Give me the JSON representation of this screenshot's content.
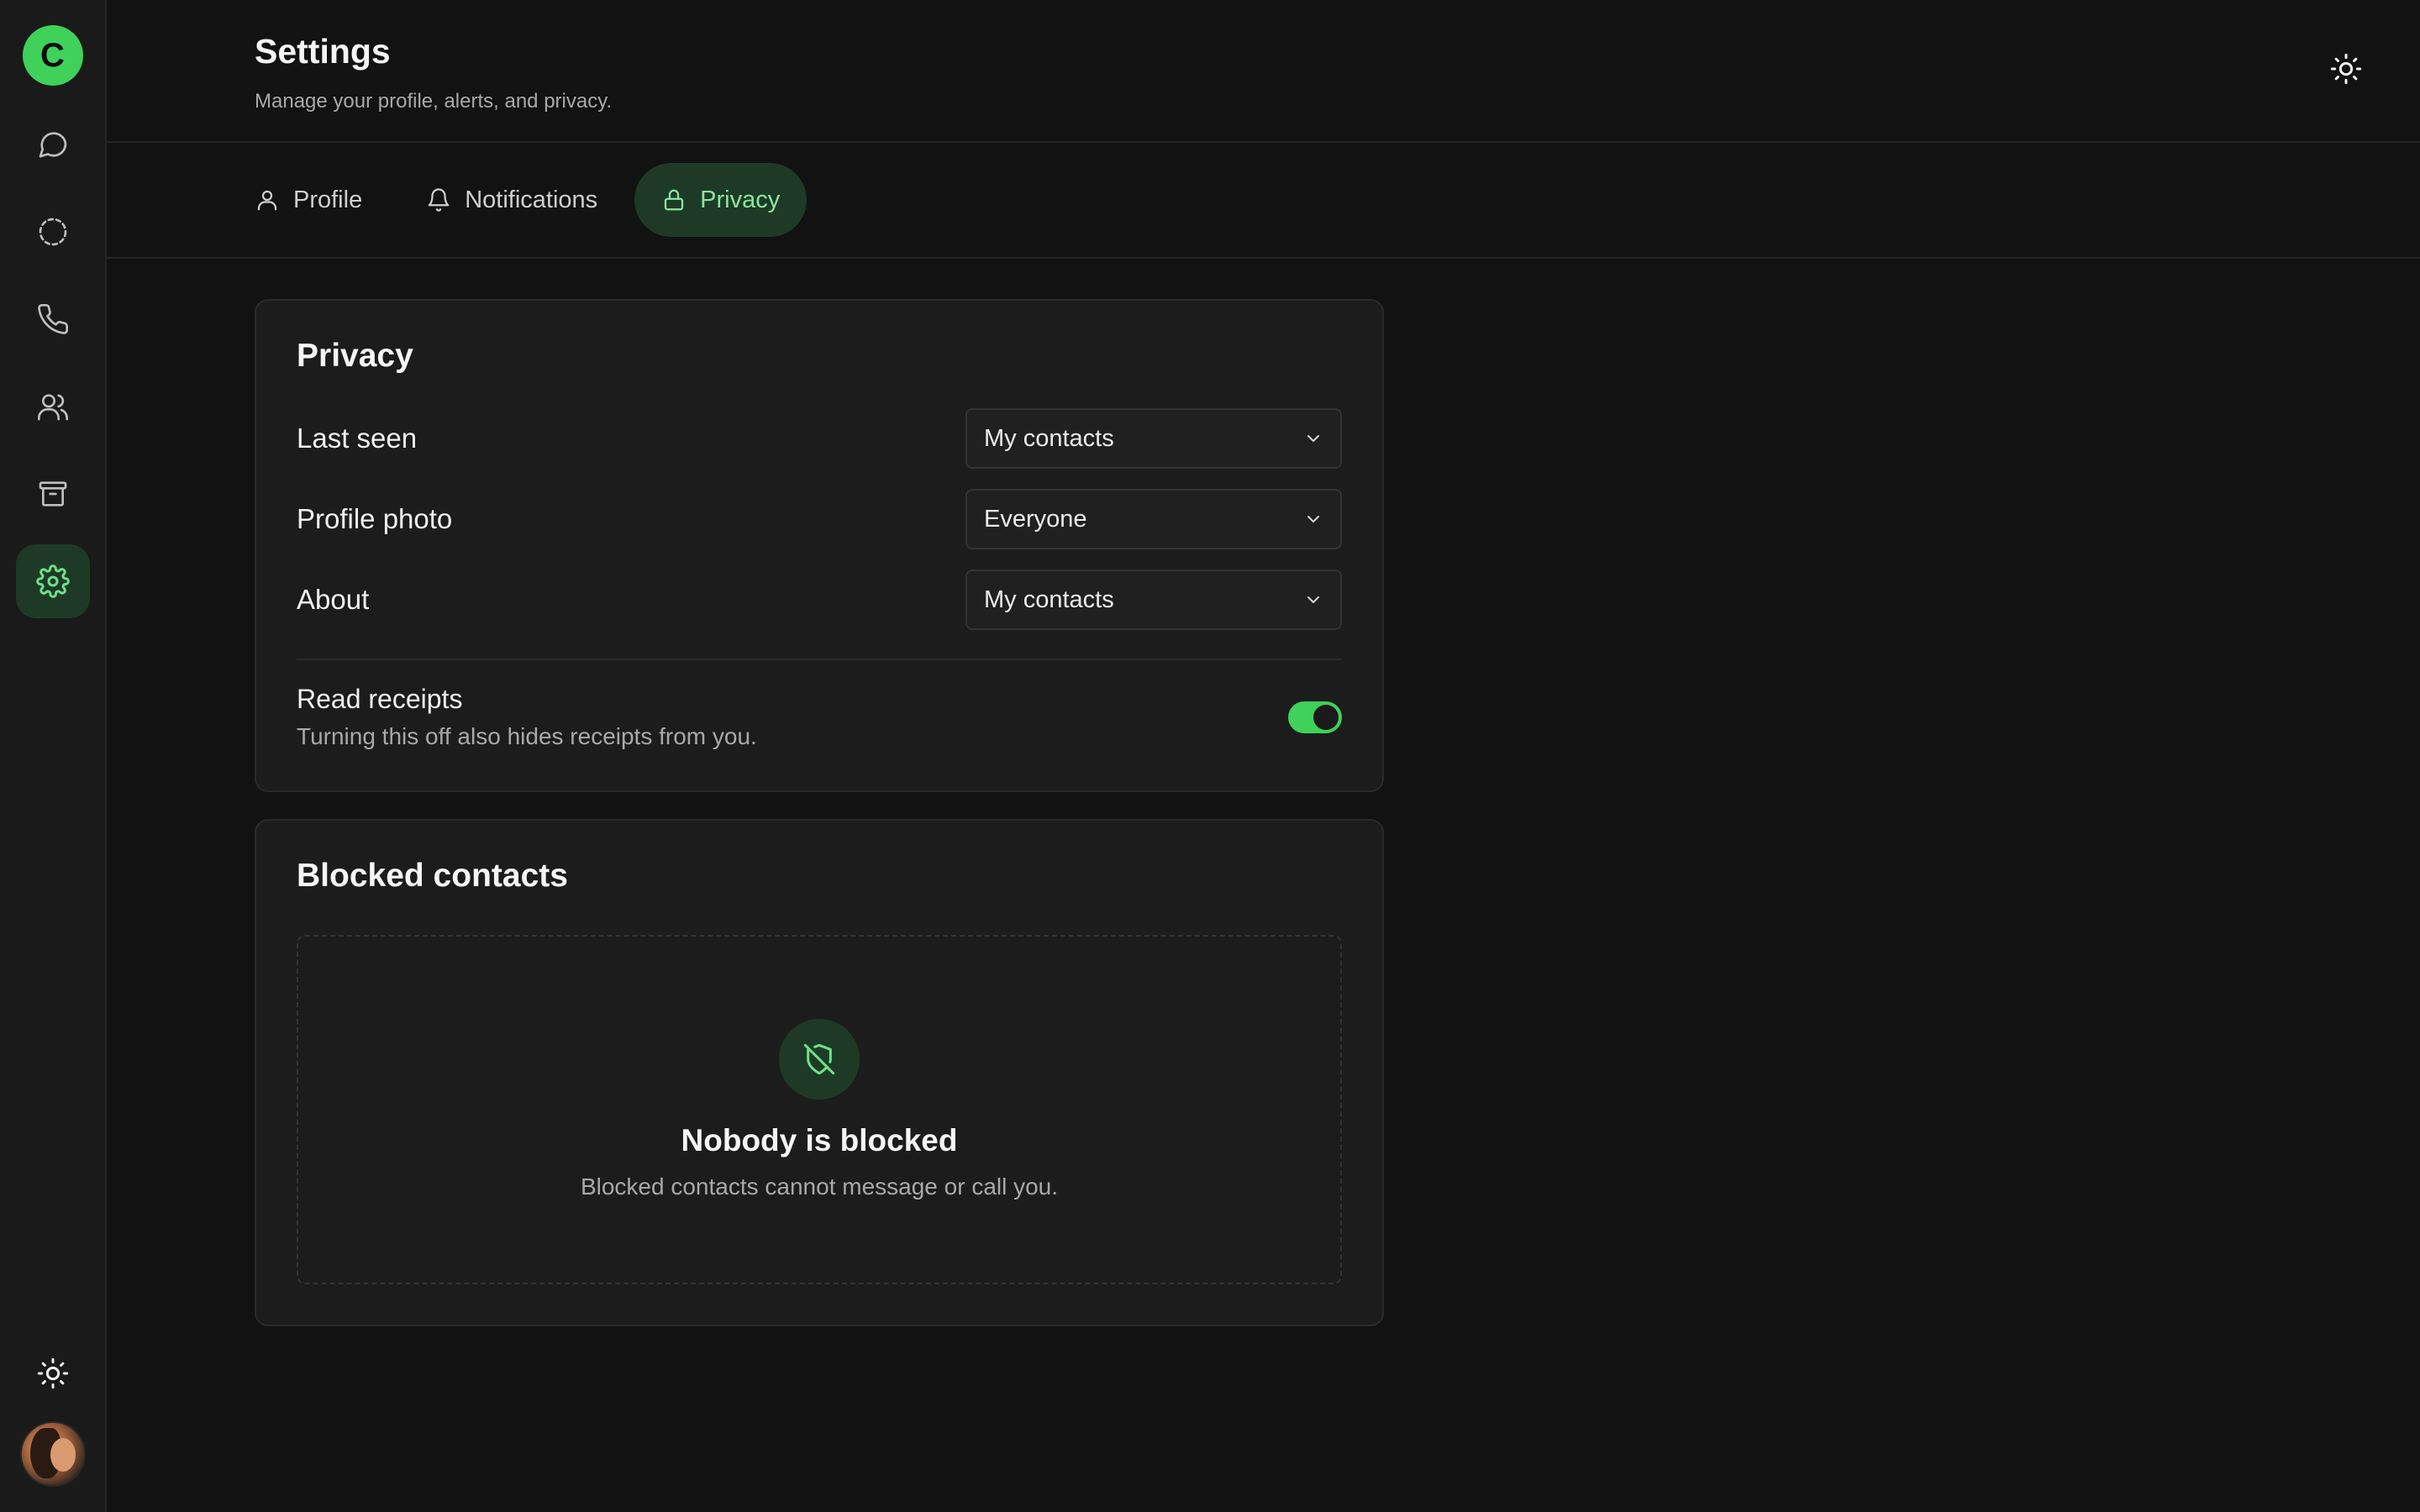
{
  "sidebar": {
    "brand_letter": "C",
    "items": [
      {
        "name": "chats",
        "icon": "chat-bubble-icon"
      },
      {
        "name": "status",
        "icon": "status-circle-icon"
      },
      {
        "name": "calls",
        "icon": "phone-icon"
      },
      {
        "name": "contacts",
        "icon": "users-icon"
      },
      {
        "name": "archive",
        "icon": "archive-icon"
      },
      {
        "name": "settings",
        "icon": "gear-icon",
        "active": true
      }
    ],
    "bottom": {
      "theme_icon": "sun-icon",
      "avatar": "user-avatar"
    }
  },
  "header": {
    "title": "Settings",
    "subtitle": "Manage your profile, alerts, and privacy.",
    "theme_icon": "sun-icon"
  },
  "tabs": [
    {
      "label": "Profile",
      "icon": "user-icon"
    },
    {
      "label": "Notifications",
      "icon": "bell-icon"
    },
    {
      "label": "Privacy",
      "icon": "lock-icon",
      "active": true
    }
  ],
  "privacy": {
    "title": "Privacy",
    "rows": [
      {
        "label": "Last seen",
        "value": "My contacts"
      },
      {
        "label": "Profile photo",
        "value": "Everyone"
      },
      {
        "label": "About",
        "value": "My contacts"
      }
    ],
    "read_receipts": {
      "label": "Read receipts",
      "description": "Turning this off also hides receipts from you.",
      "enabled": true
    }
  },
  "blocked": {
    "title": "Blocked contacts",
    "empty_title": "Nobody is blocked",
    "empty_description": "Blocked contacts cannot message or call you.",
    "empty_icon": "shield-off-icon"
  },
  "colors": {
    "accent": "#3fd15a",
    "accent_bg": "#1e3a26",
    "background": "#121212",
    "card": "#1c1c1c"
  }
}
